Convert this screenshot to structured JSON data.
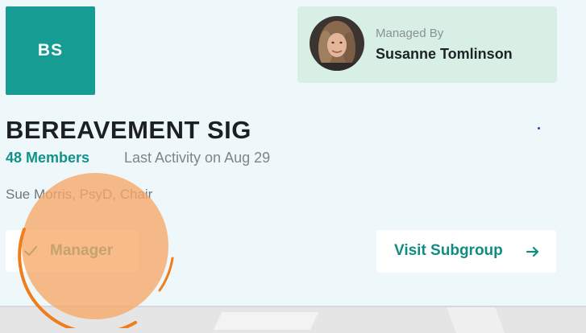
{
  "group": {
    "initials": "BS",
    "title": "BEREAVEMENT SIG",
    "members": "48 Members",
    "last_activity": "Last Activity on Aug 29",
    "chair": "Sue Morris, PsyD, Chair"
  },
  "manager": {
    "managed_by_label": "Managed By",
    "name": "Susanne Tomlinson"
  },
  "actions": {
    "manager_label": "Manager",
    "visit_label": "Visit Subgroup"
  },
  "icons": {
    "check": "check-icon",
    "arrow": "arrow-right-icon"
  },
  "colors": {
    "accent": "#169c93",
    "manager_box": "#d7efe4",
    "highlight": "#f7a866"
  }
}
